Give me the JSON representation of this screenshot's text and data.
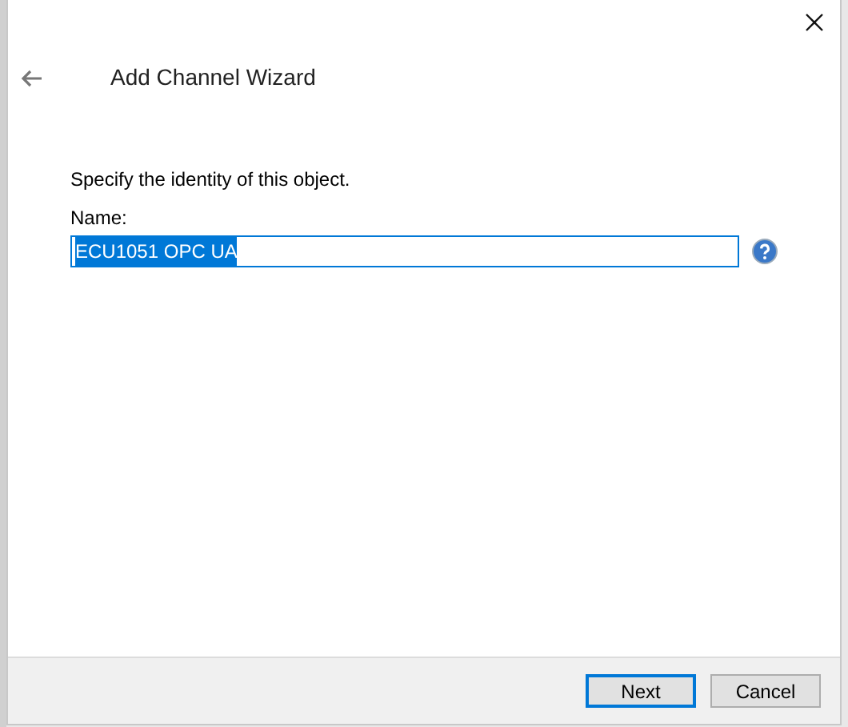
{
  "window": {
    "title": "Add Channel Wizard"
  },
  "prompt": "Specify the identity of this object.",
  "name_field": {
    "label": "Name:",
    "value": "ECU1051 OPC UA",
    "text_selected": true
  },
  "buttons": [
    {
      "label": "Next",
      "default": true
    },
    {
      "label": "Cancel",
      "default": false
    }
  ]
}
